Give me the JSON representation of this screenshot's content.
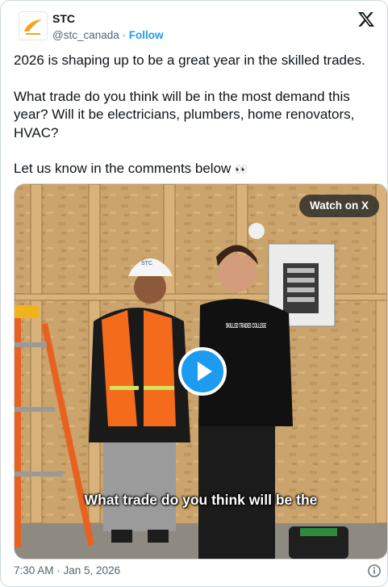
{
  "author": {
    "name": "STC",
    "handle": "@stc_canada",
    "separator": "·",
    "follow_label": "Follow",
    "avatar_icon": "stc-logo-icon"
  },
  "post": {
    "paragraphs": [
      "2026 is shaping up to be a great year in the skilled trades.",
      "What trade do you think will be in the most demand this year? Will it be electricians, plumbers, home renovators, HVAC?",
      "Let us know in the comments below"
    ],
    "emoji": "👀"
  },
  "media": {
    "watch_label": "Watch on X",
    "caption": "What trade do you think will be the",
    "hat_text": "STC",
    "hoodie_text": "SKILLED TRADES COLLEGE"
  },
  "footer": {
    "timestamp": "7:30 AM · Jan 5, 2026"
  },
  "colors": {
    "accent": "#1d9bf0",
    "text": "#0f1419",
    "muted": "#536471"
  }
}
